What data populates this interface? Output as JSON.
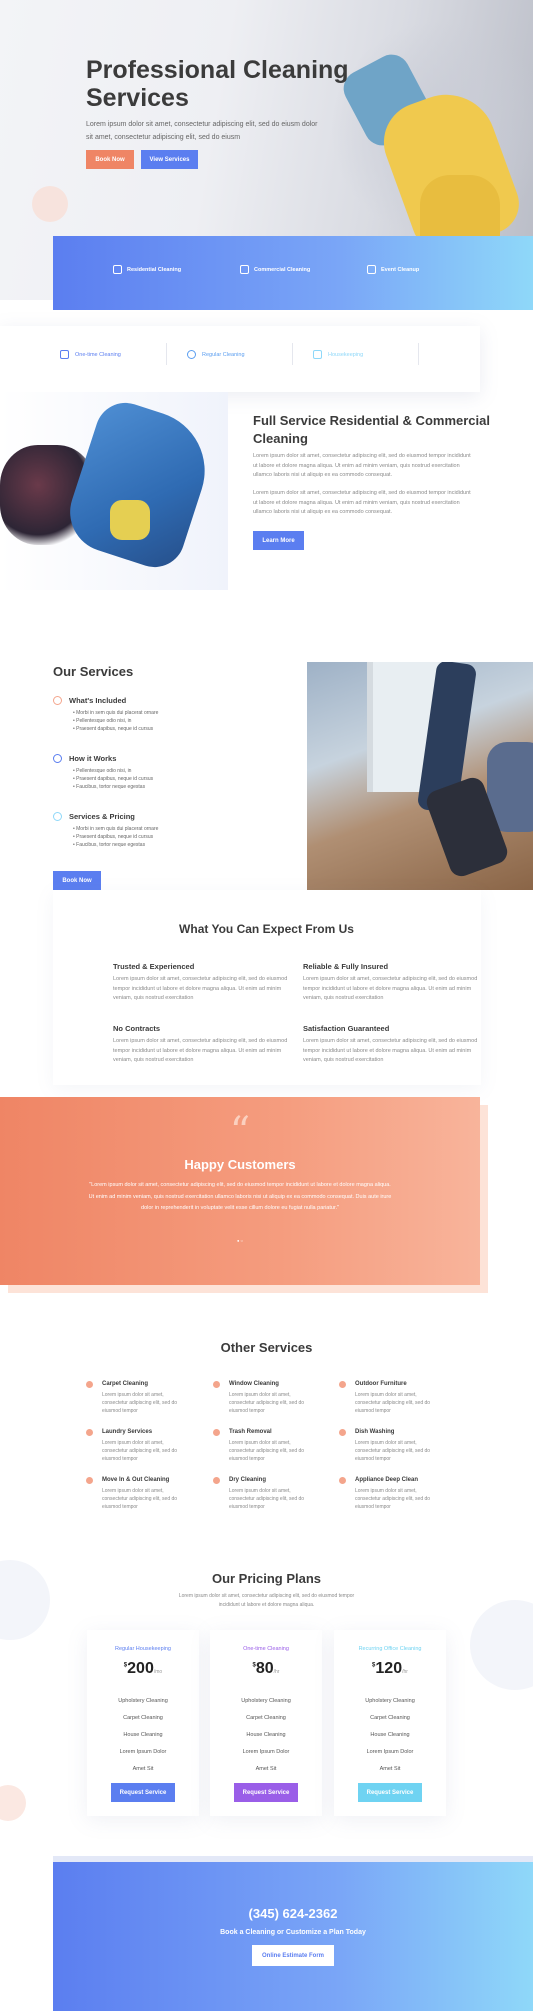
{
  "hero": {
    "title": "Professional Cleaning Services",
    "subtitle": "Lorem ipsum dolor sit amet, consectetur adipiscing elit, sed do eiusm dolor sit amet, consectetur adipiscing elit, sed do eiusm",
    "book_label": "Book Now",
    "services_label": "View Services"
  },
  "blue_bar": {
    "items": [
      {
        "label": "Residential Cleaning",
        "icon": "house-icon"
      },
      {
        "label": "Commercial Cleaning",
        "icon": "building-icon"
      },
      {
        "label": "Event Cleanup",
        "icon": "calendar-icon"
      }
    ]
  },
  "white_bar": {
    "items": [
      {
        "label": "One-time Cleaning",
        "icon": "check-square-icon"
      },
      {
        "label": "Regular Cleaning",
        "icon": "refresh-icon"
      },
      {
        "label": "Housekeeping",
        "icon": "house-icon"
      }
    ]
  },
  "full_service": {
    "title": "Full Service Residential & Commercial Cleaning",
    "p1": "Lorem ipsum dolor sit amet, consectetur adipiscing elit, sed do eiusmod tempor incididunt ut labore et dolore magna aliqua. Ut enim ad minim veniam, quis nostrud exercitation ullamco laboris nisi ut aliquip ex ea commodo consequat.",
    "p2": "Lorem ipsum dolor sit amet, consectetur adipiscing elit, sed do eiusmod tempor incididunt ut labore et dolore magna aliqua. Ut enim ad minim veniam, quis nostrud exercitation ullamco laboris nisi ut aliquip ex ea commodo consequat.",
    "button": "Learn More"
  },
  "services": {
    "title": "Our Services",
    "groups": [
      {
        "title": "What's Included",
        "bullets": [
          "Morbi in sem quis dui placerat ornare",
          "Pellentesque odio nisi, in",
          "Praesent dapibus, neque id cursus"
        ]
      },
      {
        "title": "How it Works",
        "bullets": [
          "Pellentesque odio nisi, in",
          "Praesent dapibus, neque id cursus",
          "Faucibus, tortor neque egestas"
        ]
      },
      {
        "title": "Services & Pricing",
        "bullets": [
          "Morbi in sem quis dui placerat ornare",
          "Praesent dapibus, neque id cursus",
          "Faucibus, tortor neque egestas"
        ]
      }
    ],
    "button": "Book Now"
  },
  "expect": {
    "title": "What You Can Expect From Us",
    "items": [
      {
        "title": "Trusted & Experienced",
        "text": "Lorem ipsum dolor sit amet, consectetur adipiscing elit, sed do eiusmod tempor incididunt ut labore et dolore magna aliqua. Ut enim ad minim veniam, quis nostrud exercitation"
      },
      {
        "title": "Reliable & Fully Insured",
        "text": "Lorem ipsum dolor sit amet, consectetur adipiscing elit, sed do eiusmod tempor incididunt ut labore et dolore magna aliqua. Ut enim ad minim veniam, quis nostrud exercitation"
      },
      {
        "title": "No Contracts",
        "text": "Lorem ipsum dolor sit amet, consectetur adipiscing elit, sed do eiusmod tempor incididunt ut labore et dolore magna aliqua. Ut enim ad minim veniam, quis nostrud exercitation"
      },
      {
        "title": "Satisfaction Guaranteed",
        "text": "Lorem ipsum dolor sit amet, consectetur adipiscing elit, sed do eiusmod tempor incididunt ut labore et dolore magna aliqua. Ut enim ad minim veniam, quis nostrud exercitation"
      }
    ]
  },
  "testimonial": {
    "quote_mark": "“",
    "title": "Happy Customers",
    "text": "\"Lorem ipsum dolor sit amet, consectetur adipiscing elit, sed do eiusmod tempor incididunt ut labore et dolore magna aliqua. Ut enim ad minim veniam, quis nostrud exercitation ullamco laboris nisi ut aliquip ex ea commodo consequat. Duis aute irure dolor in reprehenderit in voluptate velit esse cillum dolore eu fugiat nulla pariatur.\"",
    "dots": "● ○"
  },
  "other_services": {
    "title": "Other Services",
    "desc": "Lorem ipsum dolor sit amet, consectetur adipiscing elit, sed do eiusmod tempor",
    "items": [
      "Carpet Cleaning",
      "Window Cleaning",
      "Outdoor Furniture",
      "Laundry Services",
      "Trash Removal",
      "Dish Washing",
      "Move In & Out Cleaning",
      "Dry Cleaning",
      "Appliance Deep Clean"
    ]
  },
  "pricing": {
    "title": "Our Pricing Plans",
    "desc": "Lorem ipsum dolor sit amet, consectetur adipiscing elit, sed do eiusmod tempor incididunt ut labore et dolore magna aliqua.",
    "plans": [
      {
        "name": "Regular Housekeeping",
        "currency": "$",
        "price": "200",
        "period": "/mo",
        "color": "#5b7ef0",
        "features": [
          "Upholstery Cleaning",
          "Carpet Cleaning",
          "House Cleaning",
          "Lorem Ipsum Dolor",
          "Amet Sit"
        ],
        "button": "Request Service"
      },
      {
        "name": "One-time Cleaning",
        "currency": "$",
        "price": "80",
        "period": "/hr",
        "color": "#9a5ee8",
        "features": [
          "Upholstery Cleaning",
          "Carpet Cleaning",
          "House Cleaning",
          "Lorem Ipsum Dolor",
          "Amet Sit"
        ],
        "button": "Request Service"
      },
      {
        "name": "Recurring Office Cleaning",
        "currency": "$",
        "price": "120",
        "period": "/hr",
        "color": "#6fd3f2",
        "features": [
          "Upholstery Cleaning",
          "Carpet Cleaning",
          "House Cleaning",
          "Lorem Ipsum Dolor",
          "Amet Sit"
        ],
        "button": "Request Service"
      }
    ]
  },
  "cta": {
    "phone": "(345) 624-2362",
    "subtitle": "Book a Cleaning or Customize a Plan Today",
    "button": "Online Estimate Form"
  }
}
